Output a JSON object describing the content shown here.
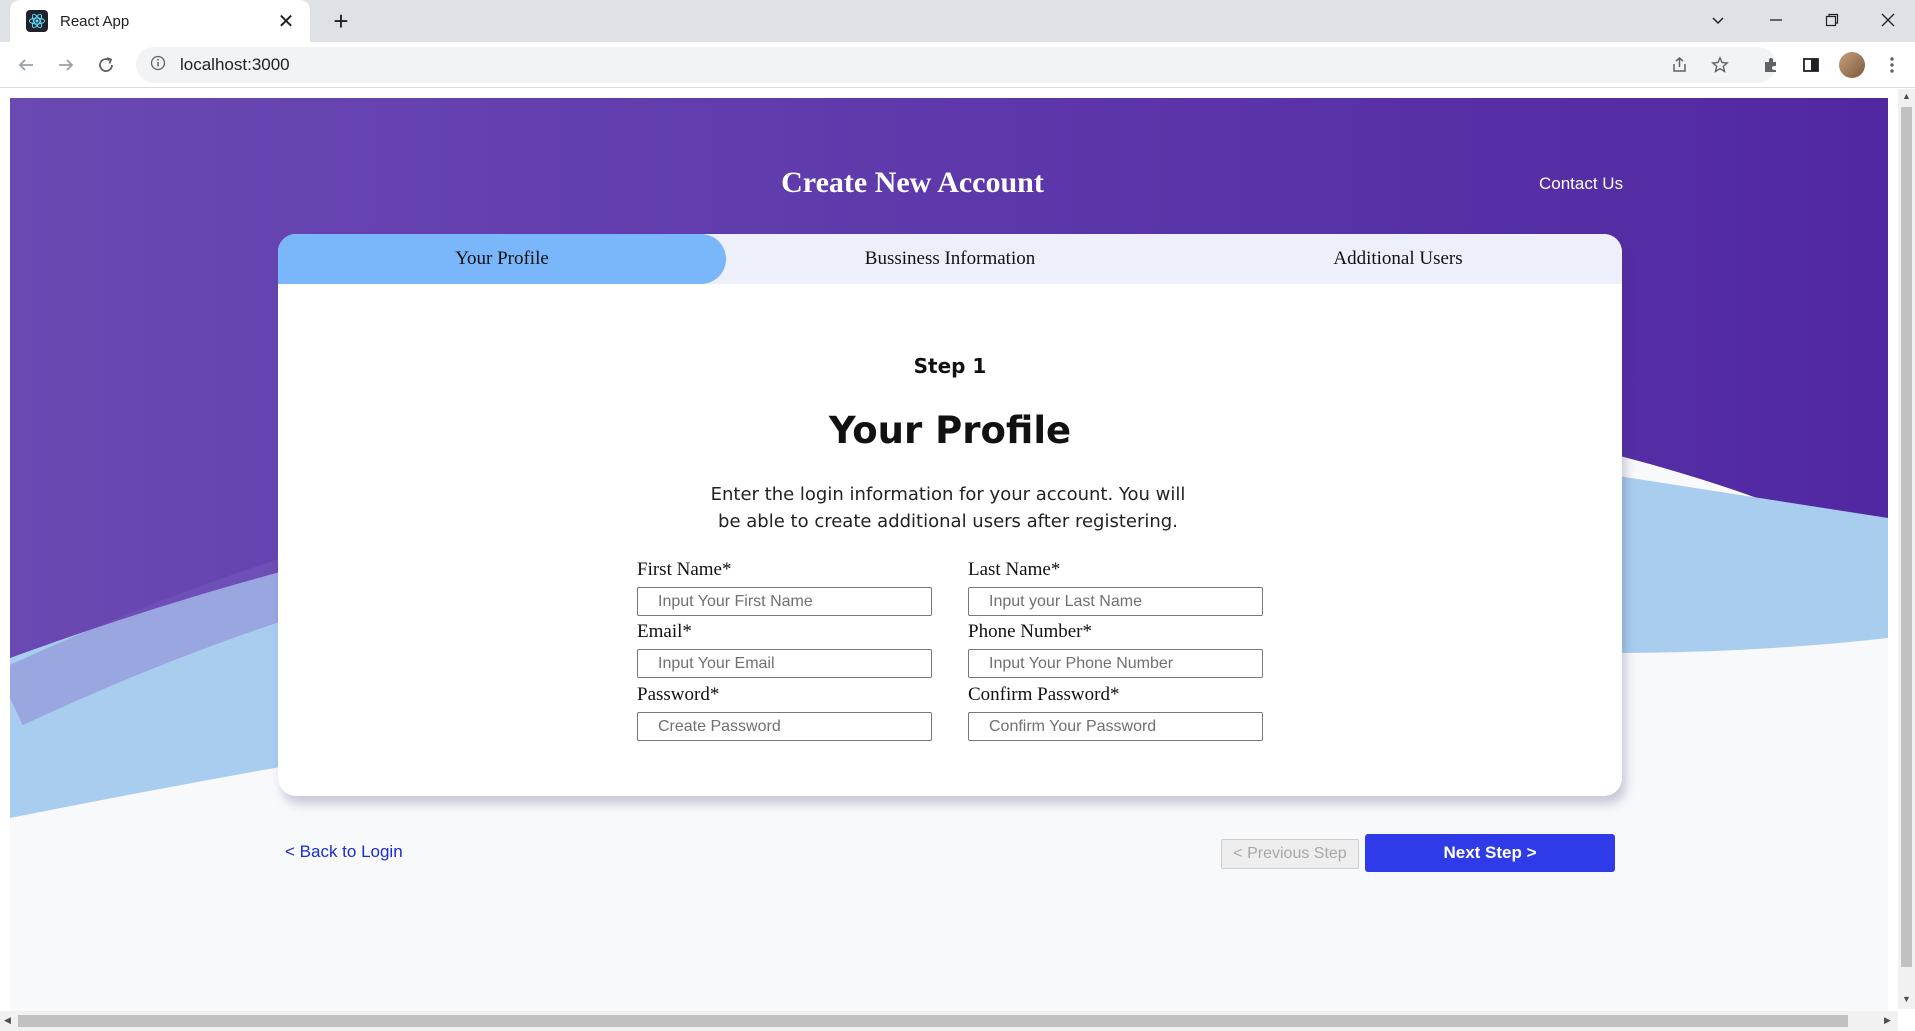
{
  "browser": {
    "tab_title": "React App",
    "tab_close": "✕",
    "new_tab": "+",
    "url": "localhost:3000"
  },
  "page": {
    "title": "Create New Account",
    "contact": "Contact Us",
    "steps": [
      "Your Profile",
      "Bussiness Information",
      "Additional Users"
    ],
    "active_step": 0,
    "step_label": "Step 1",
    "section_title": "Your Profile",
    "intro": "Enter the login information for your account. You will be able to create additional users after registering."
  },
  "form": {
    "first_name": {
      "label": "First Name*",
      "placeholder": "Input Your First Name"
    },
    "last_name": {
      "label": "Last Name*",
      "placeholder": "Input your Last Name"
    },
    "email": {
      "label": "Email*",
      "placeholder": "Input Your Email"
    },
    "phone": {
      "label": "Phone Number*",
      "placeholder": "Input Your Phone Number"
    },
    "password": {
      "label": "Password*",
      "placeholder": "Create Password"
    },
    "confirm_password": {
      "label": "Confirm Password*",
      "placeholder": "Confirm Your Password"
    }
  },
  "footer": {
    "back": "< Back to Login",
    "previous": "< Previous Step",
    "next": "Next Step >"
  },
  "colors": {
    "purple": "#5b3aa8",
    "light_blue_wave": "#a9cdef",
    "active_tab": "#79b6fa",
    "next_button": "#2f3be8"
  }
}
